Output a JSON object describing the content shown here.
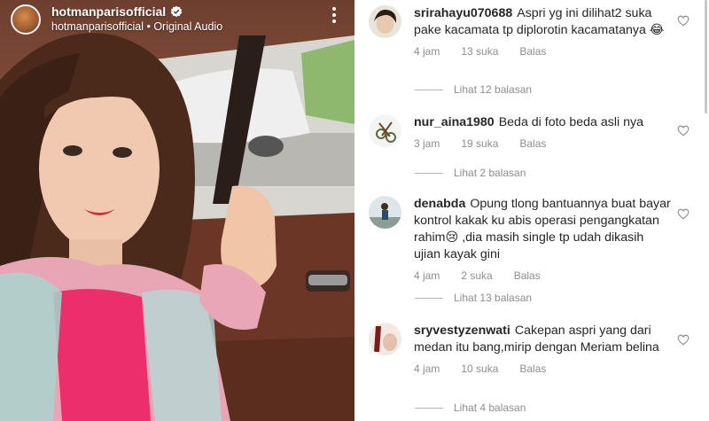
{
  "reel": {
    "username": "hotmanparisofficial",
    "subtitle": "hotmanparisofficial • Original Audio"
  },
  "comments": [
    {
      "username": "srirahayu070688",
      "text": "Aspri yg ini dilihat2 suka pake kacamata tp diplorotin kacamatanya 😂",
      "time": "4 jam",
      "likes": "13 suka",
      "reply": "Balas",
      "view_replies": "Lihat 12 balasan"
    },
    {
      "username": "nur_aina1980",
      "text": "Beda di foto beda asli nya",
      "time": "3 jam",
      "likes": "19 suka",
      "reply": "Balas",
      "view_replies": "Lihat 2 balasan"
    },
    {
      "username": "denabda",
      "text": "Opung tlong bantuannya buat bayar kontrol kakak ku abis operasi pengangkatan rahim😢 ,dia masih single tp udah dikasih ujian kayak gini",
      "time": "4 jam",
      "likes": "2 suka",
      "reply": "Balas",
      "view_replies": "Lihat 13 balasan"
    },
    {
      "username": "sryvestyzenwati",
      "text": "Cakepan aspri yang dari medan itu bang,mirip dengan Meriam belina",
      "time": "4 jam",
      "likes": "10 suka",
      "reply": "Balas",
      "view_replies": "Lihat 4 balasan"
    }
  ],
  "colors": {
    "text": "#262626",
    "meta": "#8e8e8e",
    "verified": "#3897f0"
  }
}
